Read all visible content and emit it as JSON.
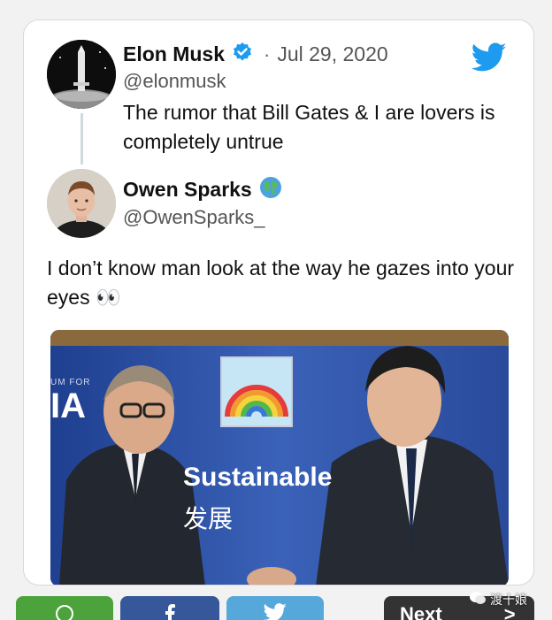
{
  "tweet": {
    "author_name": "Elon Musk",
    "separator": "·",
    "date": "Jul 29, 2020",
    "handle": "@elonmusk",
    "text": "The rumor that Bill Gates & I are lovers is completely untrue"
  },
  "reply": {
    "author_name": "Owen Sparks",
    "handle": "@OwenSparks_",
    "text": "I don’t know man look at the way he gazes into your eyes 👀"
  },
  "photo": {
    "banner_text": "Sustainable",
    "banner_chinese": "发展",
    "forum_small": "UM FOR",
    "forum_big": "IA"
  },
  "share_bar": {
    "next_label": "Next",
    "next_arrow": ">"
  },
  "watermark": {
    "text": "渡十娘"
  },
  "colors": {
    "twitter_blue": "#1d9bf0",
    "verified_blue": "#1d9bf0",
    "whatsapp_green": "#4ca33c",
    "facebook_blue": "#36589a",
    "twitter_share": "#55a8d9"
  },
  "icons": {
    "verified": "verified-badge-icon",
    "globe": "globe-icon",
    "bird": "twitter-bird-icon",
    "whatsapp": "whatsapp-icon",
    "facebook": "facebook-icon",
    "twitter_share": "twitter-share-icon",
    "wechat": "wechat-icon"
  }
}
